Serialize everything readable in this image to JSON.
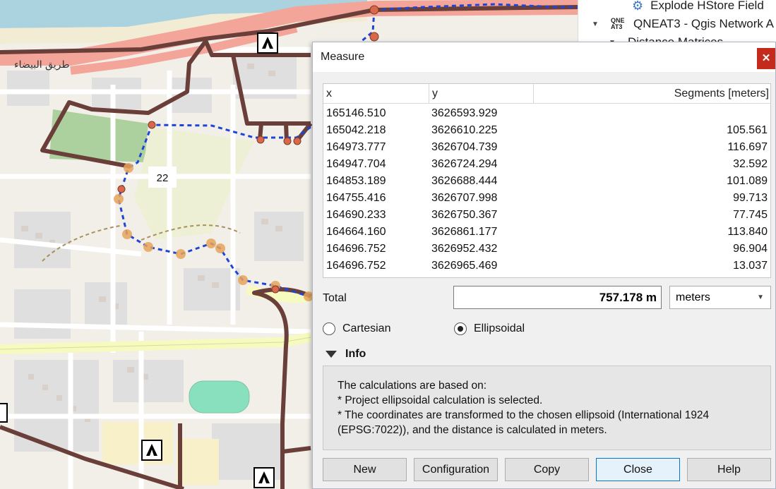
{
  "map": {
    "road_label_arabic": "طريق البيضاء",
    "route_label": "22"
  },
  "processing_panel": {
    "items": [
      {
        "label": "Explode HStore Field",
        "icon": "gear-icon"
      },
      {
        "label": "QNEAT3 - Qgis Network A",
        "icon": "qneat3-icon"
      },
      {
        "label": "Distance Matrices",
        "icon": "chevron-down-icon"
      }
    ]
  },
  "dialog": {
    "title": "Measure",
    "close_icon": "close-icon",
    "table": {
      "headers": [
        "x",
        "y",
        "Segments [meters]"
      ],
      "rows": [
        {
          "x": "165146.510",
          "y": "3626593.929",
          "seg": ""
        },
        {
          "x": "165042.218",
          "y": "3626610.225",
          "seg": "105.561"
        },
        {
          "x": "164973.777",
          "y": "3626704.739",
          "seg": "116.697"
        },
        {
          "x": "164947.704",
          "y": "3626724.294",
          "seg": "32.592"
        },
        {
          "x": "164853.189",
          "y": "3626688.444",
          "seg": "101.089"
        },
        {
          "x": "164755.416",
          "y": "3626707.998",
          "seg": "99.713"
        },
        {
          "x": "164690.233",
          "y": "3626750.367",
          "seg": "77.745"
        },
        {
          "x": "164664.160",
          "y": "3626861.177",
          "seg": "113.840"
        },
        {
          "x": "164696.752",
          "y": "3626952.432",
          "seg": "96.904"
        },
        {
          "x": "164696.752",
          "y": "3626965.469",
          "seg": "13.037"
        }
      ]
    },
    "total_label": "Total",
    "total_value": "757.178 m",
    "units": "meters",
    "radio_cartesian": "Cartesian",
    "radio_ellipsoidal": "Ellipsoidal",
    "info_title": "Info",
    "info_lines": [
      "The calculations are based on:",
      "* Project ellipsoidal calculation is selected.",
      "* The coordinates are transformed to the chosen ellipsoid (International 1924",
      "(EPSG:7022)), and the distance is calculated in meters."
    ],
    "buttons": {
      "new": "New",
      "configuration": "Configuration",
      "copy": "Copy",
      "close": "Close",
      "help": "Help"
    }
  }
}
